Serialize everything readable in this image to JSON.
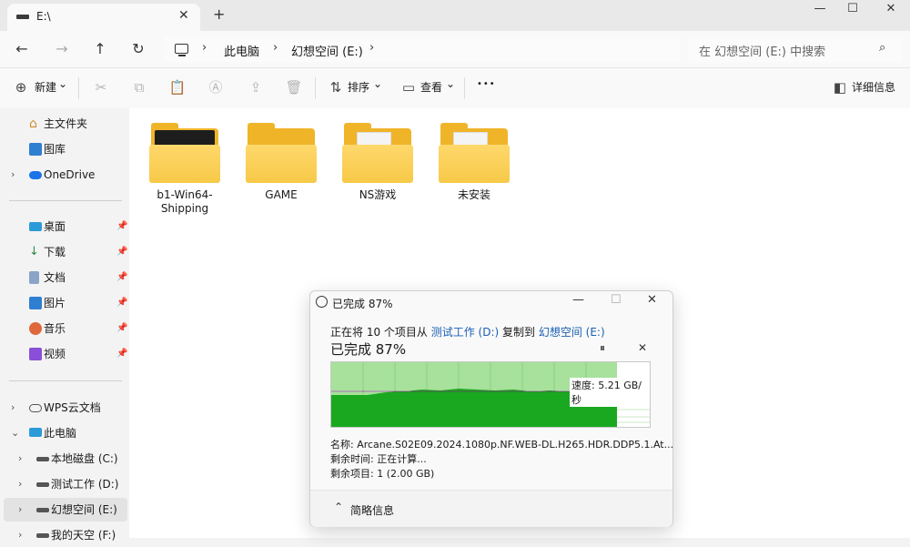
{
  "window": {
    "tab_title": "E:\\",
    "tab_close": "✕",
    "new_tab": "+",
    "minimize": "—",
    "maximize": "☐",
    "close": "✕"
  },
  "nav": {
    "back": "←",
    "forward": "→",
    "up": "↑",
    "refresh": "↻"
  },
  "breadcrumb": {
    "sep": "›",
    "items": [
      "此电脑",
      "幻想空间 (E:)"
    ]
  },
  "search": {
    "placeholder": "在 幻想空间 (E:) 中搜索",
    "icon": "⌕"
  },
  "toolbar": {
    "new_label": "新建",
    "new_caret": "⌄",
    "sort_label": "排序",
    "view_label": "查看",
    "more": "•••",
    "details_label": "详细信息"
  },
  "sidebar": {
    "top": [
      {
        "label": "主文件夹",
        "icon": "home-icon"
      },
      {
        "label": "图库",
        "icon": "gallery-icon"
      },
      {
        "label": "OneDrive",
        "icon": "cloud-icon",
        "expand": "›"
      }
    ],
    "quick": [
      {
        "label": "桌面",
        "pin": "📌"
      },
      {
        "label": "下载",
        "pin": "📌"
      },
      {
        "label": "文档",
        "pin": "📌"
      },
      {
        "label": "图片",
        "pin": "📌"
      },
      {
        "label": "音乐",
        "pin": "📌"
      },
      {
        "label": "视频",
        "pin": "📌"
      }
    ],
    "tree": [
      {
        "label": "WPS云文档",
        "expand": "›"
      },
      {
        "label": "此电脑",
        "expand": "⌄"
      },
      {
        "label": "本地磁盘 (C:)",
        "expand": "›"
      },
      {
        "label": "测试工作 (D:)",
        "expand": "›"
      },
      {
        "label": "幻想空间 (E:)",
        "expand": "›"
      },
      {
        "label": "我的天空 (F:)",
        "expand": "›"
      }
    ]
  },
  "folders": [
    {
      "name": "b1-Win64-Shipping",
      "style": "thumb"
    },
    {
      "name": "GAME",
      "style": "empty"
    },
    {
      "name": "NS游戏",
      "style": "paper"
    },
    {
      "name": "未安装",
      "style": "paper"
    }
  ],
  "dialog": {
    "title": "已完成 87%",
    "min": "—",
    "max": "☐",
    "close": "✕",
    "line1_prefix": "正在将 10 个项目从 ",
    "source": "测试工作 (D:)",
    "line1_mid": " 复制到 ",
    "dest": "幻想空间 (E:)",
    "progress_label": "已完成 87%",
    "progress_fraction": 0.87,
    "pause": "⏸",
    "cancel": "✕",
    "speed": "速度: 5.21 GB/秒",
    "name_line": "名称:  Arcane.S02E09.2024.1080p.NF.WEB-DL.H265.HDR.DDP5.1.At...",
    "time_line": "剩余时间:  正在计算...",
    "items_line": "剩余项目:  1 (2.00 GB)",
    "toggle": "⌃",
    "less_details": "简略信息"
  }
}
